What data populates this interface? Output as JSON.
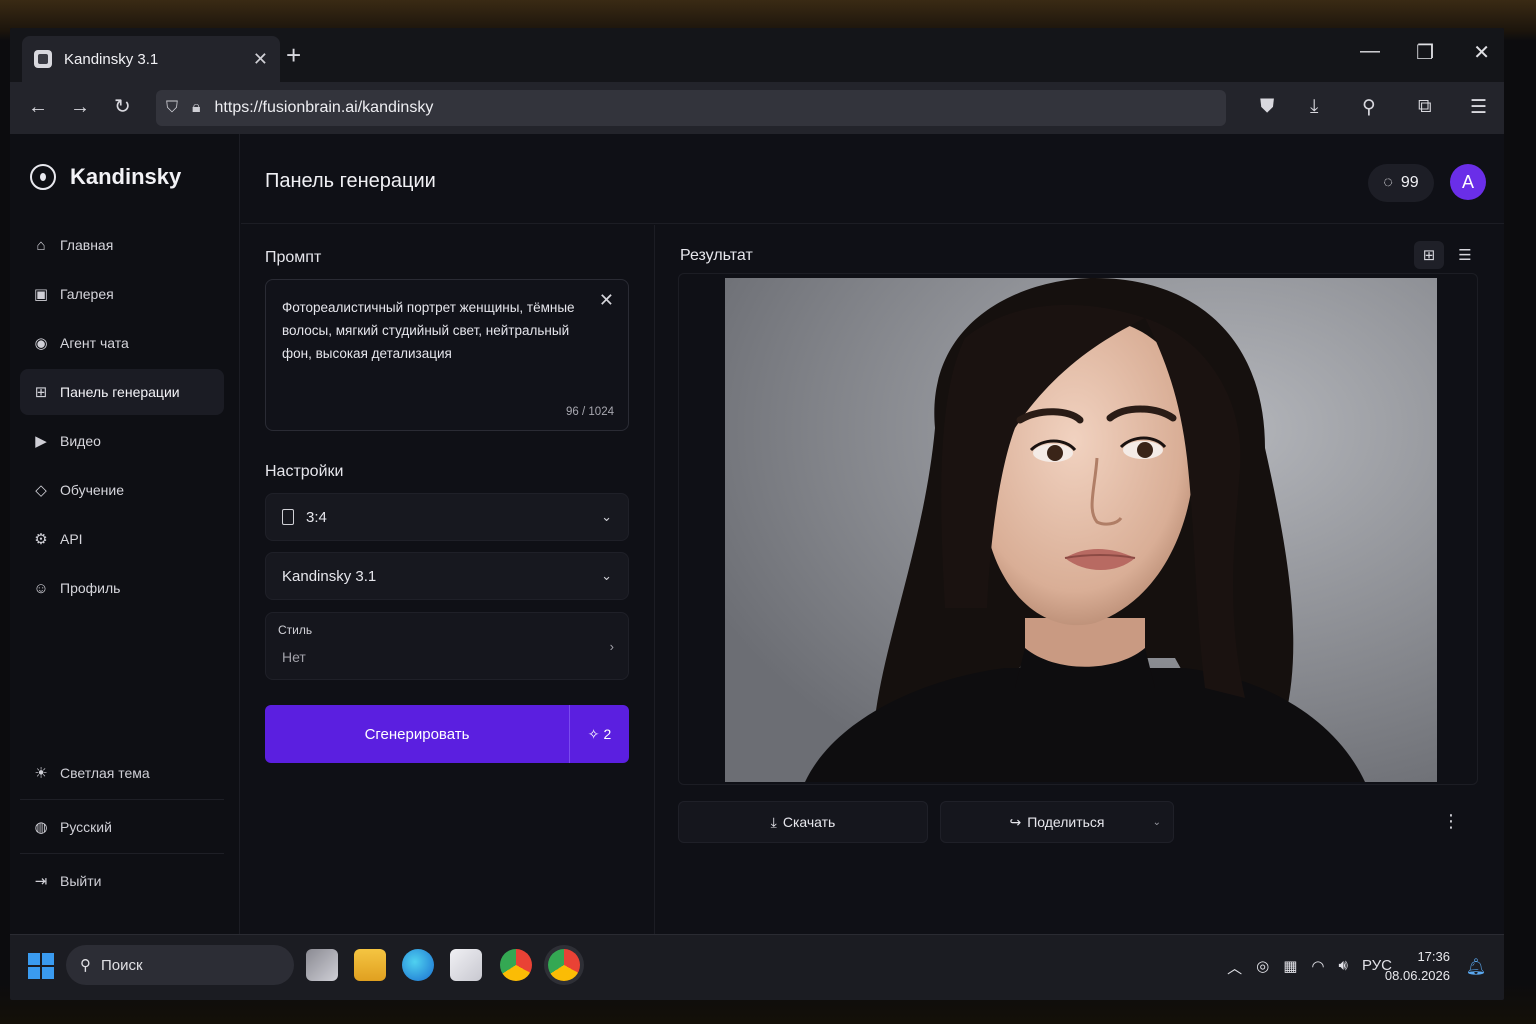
{
  "browser": {
    "tab_title": "Kandinsky 3.1",
    "url": "https://fusionbrain.ai/kandinsky"
  },
  "sidebar": {
    "brand": "Kandinsky",
    "items": [
      {
        "label": "Главная",
        "icon": "home-icon"
      },
      {
        "label": "Галерея",
        "icon": "gallery-icon"
      },
      {
        "label": "Агент чата",
        "icon": "chat-agent-icon"
      },
      {
        "label": "Панель генерации",
        "icon": "generation-panel-icon",
        "active": true
      },
      {
        "label": "Видео",
        "icon": "video-icon"
      },
      {
        "label": "Обучение",
        "icon": "learning-icon"
      },
      {
        "label": "API",
        "icon": "api-icon"
      },
      {
        "label": "Профиль",
        "icon": "profile-icon"
      }
    ],
    "bottom": [
      {
        "label": "Светлая тема",
        "icon": "sun-icon"
      },
      {
        "label": "Русский",
        "icon": "globe-icon"
      },
      {
        "label": "Выйти",
        "icon": "logout-icon"
      }
    ]
  },
  "header": {
    "title": "Панель генерации",
    "credits": "99",
    "avatar_letter": "A"
  },
  "prompt": {
    "label": "Промпт",
    "text": "Фотореалистичный портрет женщины, тёмные волосы, мягкий студийный свет, нейтральный фон, высокая детализация",
    "counter": "96 / 1024"
  },
  "settings": {
    "label": "Настройки",
    "aspect_ratio": "3:4",
    "model": "Kandinsky 3.1",
    "style_label": "Стиль",
    "style_value": "Нет"
  },
  "generate": {
    "label": "Сгенерировать",
    "count": "2"
  },
  "result": {
    "label": "Результат",
    "download": "Скачать",
    "share": "Поделиться"
  },
  "taskbar": {
    "search": "Поиск",
    "lang": "РУС",
    "time": "17:36",
    "date": "08.06.2026"
  },
  "colors": {
    "accent": "#5b1fe0",
    "avatar": "#6a2ee8",
    "background": "#0f1016"
  }
}
